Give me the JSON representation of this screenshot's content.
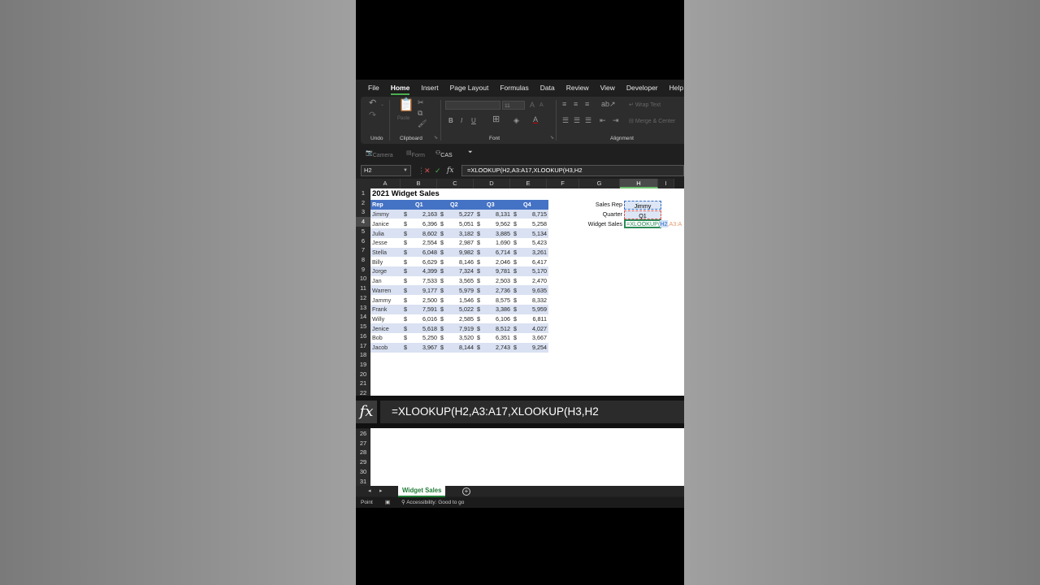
{
  "menu": [
    "File",
    "Home",
    "Insert",
    "Page Layout",
    "Formulas",
    "Data",
    "Review",
    "View",
    "Developer",
    "Help",
    "Acro"
  ],
  "ribbon": {
    "undo_label": "Undo",
    "clipboard_label": "Clipboard",
    "paste_label": "Paste",
    "font_label": "Font",
    "font_size": "11",
    "alignment_label": "Alignment",
    "wrap_text": "Wrap Text",
    "merge_center": "Merge & Center",
    "bold": "B",
    "italic": "I",
    "underline": "U"
  },
  "qat": {
    "camera": "Camera",
    "form": "Form",
    "cas": "CAS"
  },
  "formula_bar": {
    "name_box": "H2",
    "formula": "=XLOOKUP(H2,A3:A17,XLOOKUP(H3,H2"
  },
  "columns": [
    "A",
    "B",
    "C",
    "D",
    "E",
    "F",
    "G",
    "H",
    "I"
  ],
  "rows_upper": [
    "1",
    "2",
    "3",
    "4",
    "5",
    "6",
    "7",
    "8",
    "9",
    "10",
    "11",
    "12",
    "13",
    "14",
    "15",
    "16",
    "17",
    "18",
    "19",
    "20",
    "21",
    "22"
  ],
  "rows_lower": [
    "26",
    "27",
    "28",
    "29",
    "30",
    "31"
  ],
  "sheet": {
    "title": "2021 Widget Sales",
    "headers": [
      "Rep",
      "Q1",
      "Q2",
      "Q3",
      "Q4"
    ],
    "currency": "$",
    "rows": [
      {
        "rep": "Jimmy",
        "q1": "2,163",
        "q2": "5,227",
        "q3": "8,131",
        "q4": "8,715"
      },
      {
        "rep": "Janice",
        "q1": "6,396",
        "q2": "5,051",
        "q3": "9,562",
        "q4": "5,258"
      },
      {
        "rep": "Julia",
        "q1": "8,602",
        "q2": "3,182",
        "q3": "3,885",
        "q4": "5,134"
      },
      {
        "rep": "Jesse",
        "q1": "2,554",
        "q2": "2,987",
        "q3": "1,690",
        "q4": "5,423"
      },
      {
        "rep": "Stella",
        "q1": "6,048",
        "q2": "9,982",
        "q3": "6,714",
        "q4": "3,261"
      },
      {
        "rep": "Billy",
        "q1": "6,629",
        "q2": "8,146",
        "q3": "2,046",
        "q4": "6,417"
      },
      {
        "rep": "Jorge",
        "q1": "4,399",
        "q2": "7,324",
        "q3": "9,781",
        "q4": "5,170"
      },
      {
        "rep": "Jan",
        "q1": "7,533",
        "q2": "3,565",
        "q3": "2,503",
        "q4": "2,470"
      },
      {
        "rep": "Warren",
        "q1": "9,177",
        "q2": "5,979",
        "q3": "2,736",
        "q4": "9,635"
      },
      {
        "rep": "Jammy",
        "q1": "2,500",
        "q2": "1,546",
        "q3": "8,575",
        "q4": "8,332"
      },
      {
        "rep": "Frank",
        "q1": "7,591",
        "q2": "5,022",
        "q3": "3,386",
        "q4": "5,959"
      },
      {
        "rep": "Willy",
        "q1": "6,016",
        "q2": "2,585",
        "q3": "6,106",
        "q4": "6,811"
      },
      {
        "rep": "Jenice",
        "q1": "5,618",
        "q2": "7,919",
        "q3": "8,512",
        "q4": "4,027"
      },
      {
        "rep": "Bob",
        "q1": "5,250",
        "q2": "3,520",
        "q3": "6,351",
        "q4": "3,667"
      },
      {
        "rep": "Jacob",
        "q1": "3,967",
        "q2": "8,144",
        "q3": "2,743",
        "q4": "9,254"
      }
    ],
    "lookup": {
      "sales_rep_label": "Sales Rep",
      "sales_rep_value": "Jimmy",
      "quarter_label": "Quarter",
      "quarter_value": "Q1",
      "widget_sales_label": "Widget Sales",
      "widget_sales_typed": "=XLOOKUP(",
      "widget_sales_ref": "H2",
      "widget_sales_ghost": ",A3:A"
    }
  },
  "big_formula": {
    "fx": "fx",
    "text": "=XLOOKUP(H2,A3:A17,XLOOKUP(H3,H2"
  },
  "tabs": {
    "active": "Widget Sales",
    "prev": "◂",
    "next": "▸",
    "add": "+"
  },
  "status": {
    "mode": "Point",
    "accessibility": "Accessibility: Good to go"
  },
  "colors": {
    "table_header": "#4472c4",
    "band": "#d9e1f2",
    "excel_green": "#1e7b34"
  }
}
